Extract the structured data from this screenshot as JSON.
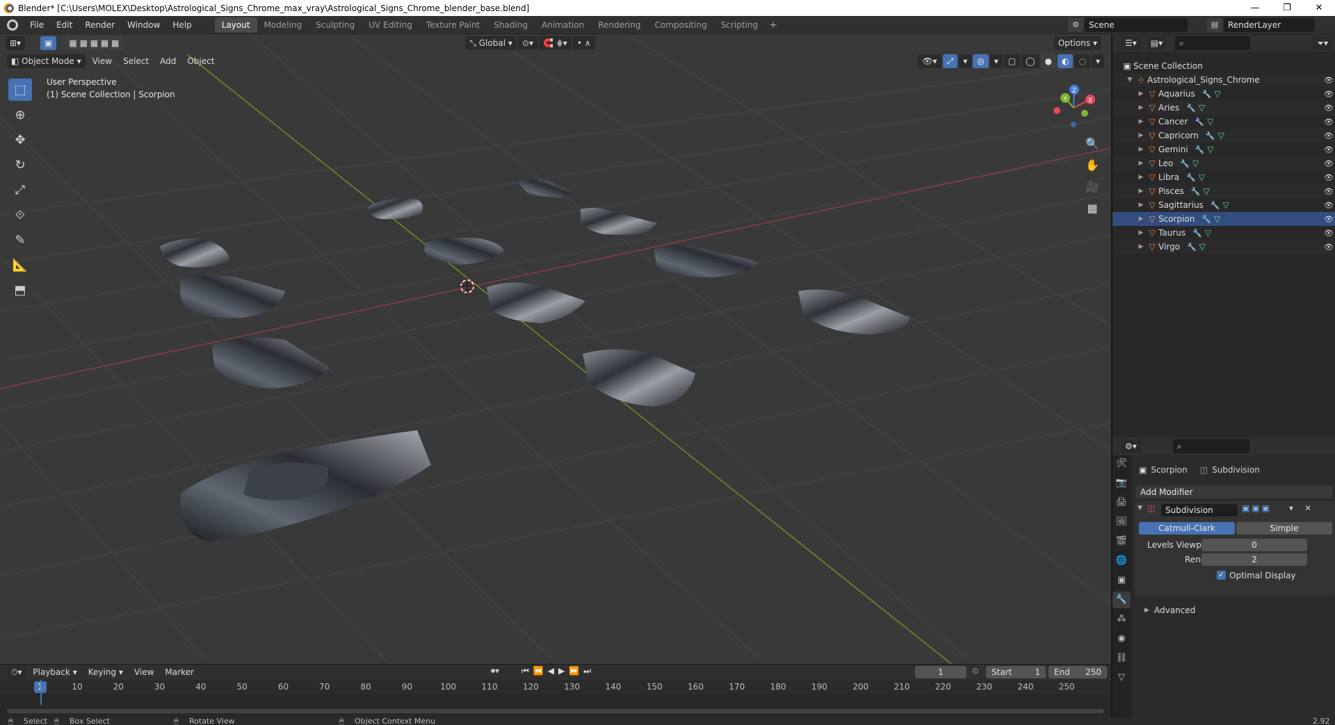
{
  "window": {
    "title": "Blender* [C:\\Users\\MOLEX\\Desktop\\Astrological_Signs_Chrome_max_vray\\Astrological_Signs_Chrome_blender_base.blend]",
    "controls": [
      "—",
      "❐",
      "✕"
    ]
  },
  "menu": [
    "File",
    "Edit",
    "Render",
    "Window",
    "Help"
  ],
  "workspaces": [
    "Layout",
    "Modeling",
    "Sculpting",
    "UV Editing",
    "Texture Paint",
    "Shading",
    "Animation",
    "Rendering",
    "Compositing",
    "Scripting"
  ],
  "active_workspace": "Layout",
  "scene": {
    "name": "Scene",
    "render_layer": "RenderLayer"
  },
  "viewport": {
    "mode": "Object Mode",
    "menus": [
      "View",
      "Select",
      "Add",
      "Object"
    ],
    "orientation": "Global",
    "options_label": "Options",
    "info_line1": "User Perspective",
    "info_line2": "(1) Scene Collection | Scorpion",
    "gizmo_labels": {
      "x": "X",
      "y": "Y",
      "z": "Z"
    }
  },
  "outliner": {
    "root": "Scene Collection",
    "collection": "Astrological_Signs_Chrome",
    "objects": [
      "Aquarius",
      "Aries",
      "Cancer",
      "Capricorn",
      "Gemini",
      "Leo",
      "Libra",
      "Pisces",
      "Sagittarius",
      "Scorpion",
      "Taurus",
      "Virgo"
    ],
    "selected": "Scorpion"
  },
  "properties": {
    "object_name": "Scorpion",
    "modifier_context": "Subdivision",
    "add_modifier": "Add Modifier",
    "modifier_name": "Subdivision",
    "type_catmull": "Catmull-Clark",
    "type_simple": "Simple",
    "levels_viewport_label": "Levels Viewport",
    "levels_viewport_value": "0",
    "render_label": "Render",
    "render_value": "2",
    "optimal_display": "Optimal Display",
    "advanced": "Advanced"
  },
  "timeline": {
    "menus": [
      "Playback",
      "Keying",
      "View",
      "Marker"
    ],
    "current_frame": "1",
    "start_label": "Start",
    "start_value": "1",
    "end_label": "End",
    "end_value": "250",
    "ticks": [
      "10",
      "20",
      "30",
      "40",
      "50",
      "60",
      "70",
      "80",
      "90",
      "100",
      "110",
      "120",
      "130",
      "140",
      "150",
      "160",
      "170",
      "180",
      "190",
      "200",
      "210",
      "220",
      "230",
      "240",
      "250"
    ]
  },
  "statusbar": {
    "select": "Select",
    "box_select": "Box Select",
    "rotate_view": "Rotate View",
    "context_menu": "Object Context Menu",
    "version": "2.92"
  }
}
